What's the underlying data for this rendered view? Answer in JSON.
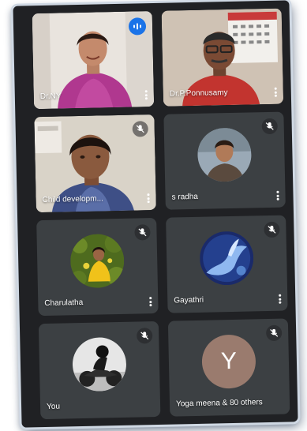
{
  "participants": [
    {
      "name": "Dr.NY",
      "state": "speaking"
    },
    {
      "name": "Dr.P.Ponnusamy",
      "state": "unmuted"
    },
    {
      "name": "Child developm...",
      "state": "muted"
    },
    {
      "name": "s radha",
      "state": "muted"
    },
    {
      "name": "Charulatha",
      "state": "muted"
    },
    {
      "name": "Gayathri",
      "state": "muted"
    },
    {
      "name": "You",
      "state": "muted"
    },
    {
      "name": "Yoga meena & 80 others",
      "state": "muted",
      "avatar_letter": "Y"
    }
  ],
  "colors": {
    "background": "#202124",
    "tile": "#3c4043",
    "speaking_badge": "#1a73e8",
    "letter_avatar": "#9a7b6e"
  },
  "icons": {
    "mute": "mic-off-icon",
    "speaking": "audio-level-icon",
    "more": "more-vert-icon"
  }
}
